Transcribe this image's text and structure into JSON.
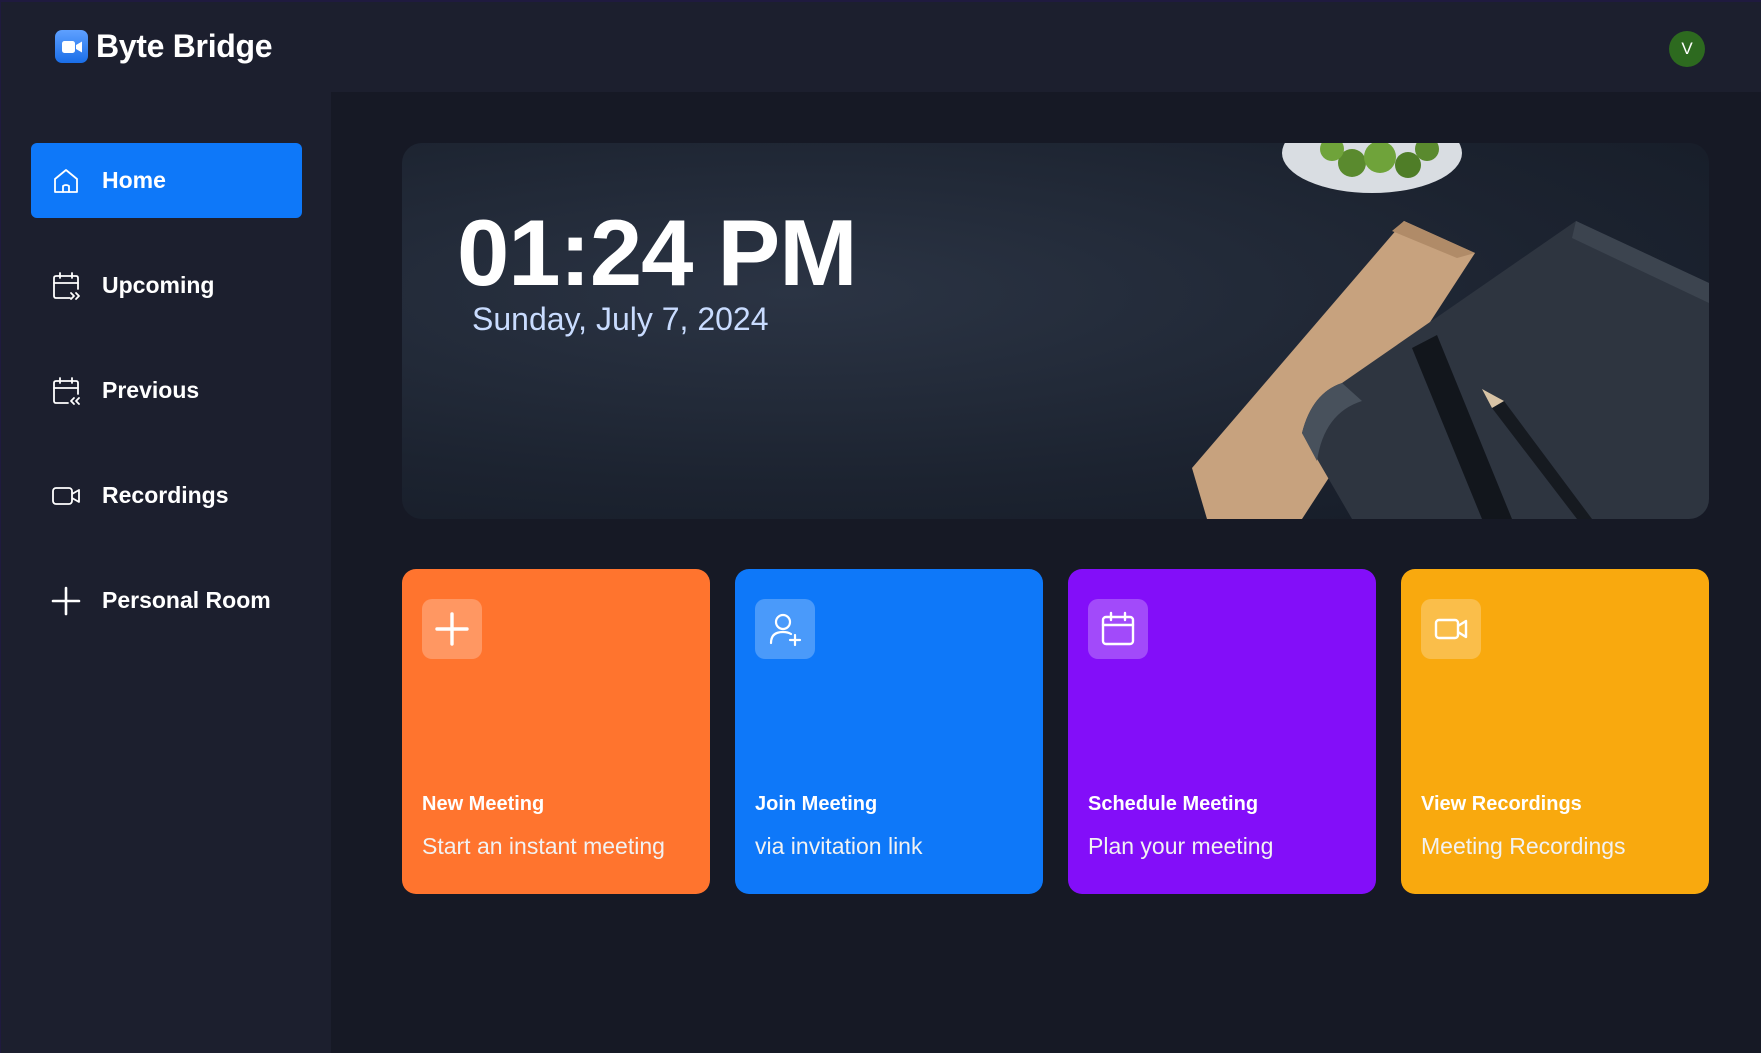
{
  "app": {
    "name": "Byte Bridge",
    "logo_icon": "video-camera-icon"
  },
  "user": {
    "avatar_initial": "V",
    "avatar_color": "#2d6a1f"
  },
  "sidebar": {
    "items": [
      {
        "label": "Home",
        "icon": "home-icon",
        "active": true
      },
      {
        "label": "Upcoming",
        "icon": "calendar-forward-icon",
        "active": false
      },
      {
        "label": "Previous",
        "icon": "calendar-back-icon",
        "active": false
      },
      {
        "label": "Recordings",
        "icon": "video-icon",
        "active": false
      },
      {
        "label": "Personal Room",
        "icon": "plus-icon",
        "active": false
      }
    ]
  },
  "hero": {
    "time": "01:24 PM",
    "date": "Sunday, July 7, 2024"
  },
  "cards": [
    {
      "title": "New Meeting",
      "subtitle": "Start an instant meeting",
      "icon": "plus-icon",
      "color": "#ff742e"
    },
    {
      "title": "Join Meeting",
      "subtitle": "via invitation link",
      "icon": "add-user-icon",
      "color": "#0e78f9"
    },
    {
      "title": "Schedule Meeting",
      "subtitle": "Plan your meeting",
      "icon": "calendar-icon",
      "color": "#830ef9"
    },
    {
      "title": "View Recordings",
      "subtitle": "Meeting Recordings",
      "icon": "video-icon",
      "color": "#f9a90e"
    }
  ],
  "colors": {
    "accent": "#0e78f9",
    "background": "#161925",
    "panel": "#1c1f2e"
  }
}
